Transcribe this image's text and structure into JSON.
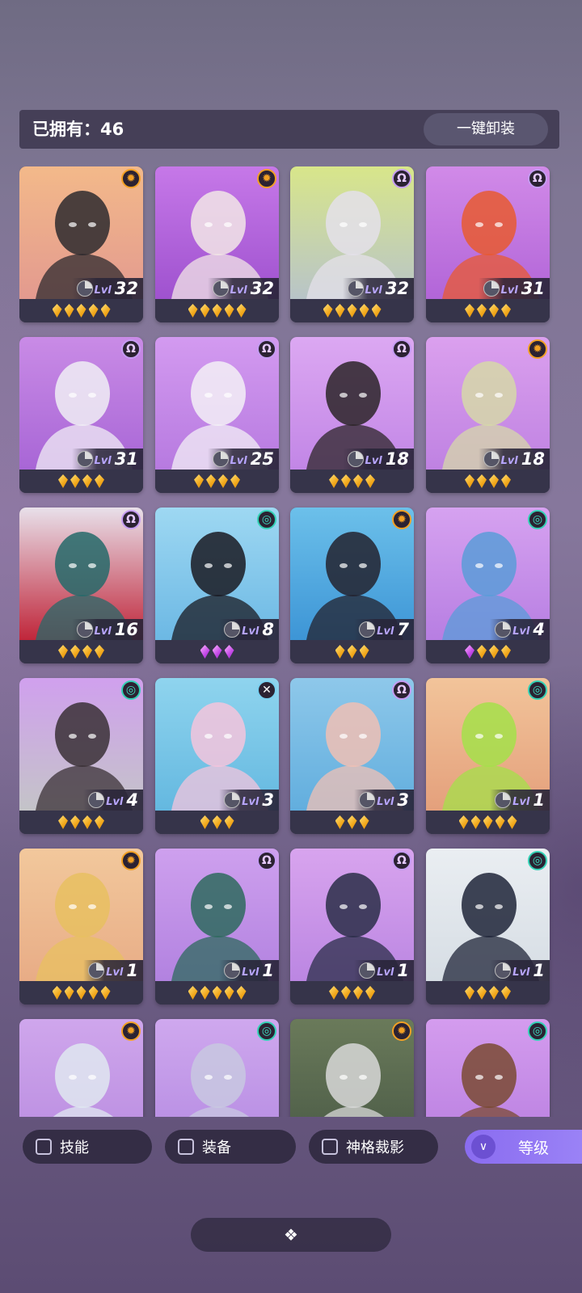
{
  "header": {
    "owned_label": "已拥有：46",
    "unequip_all": "一键卸装"
  },
  "cards": [
    {
      "level": "32",
      "lvl_label": "Lvl",
      "stars": 5,
      "gem": "gold",
      "faction_icon": "sun-icon",
      "bg": [
        "#f3b98a",
        "#e39a8f"
      ],
      "tone": "#2d2a2e"
    },
    {
      "level": "32",
      "lvl_label": "Lvl",
      "stars": 5,
      "gem": "gold",
      "faction_icon": "sun-icon",
      "bg": [
        "#c678e8",
        "#9f52cf"
      ],
      "tone": "#f2e6e6"
    },
    {
      "level": "32",
      "lvl_label": "Lvl",
      "stars": 5,
      "gem": "gold",
      "faction_icon": "omega-icon",
      "bg": [
        "#d8e68a",
        "#b8c4c8"
      ],
      "tone": "#e4e0ea"
    },
    {
      "level": "31",
      "lvl_label": "Lvl",
      "stars": 4,
      "gem": "gold",
      "faction_icon": "omega-icon",
      "bg": [
        "#d18ae8",
        "#b265d8"
      ],
      "tone": "#e85a30"
    },
    {
      "level": "31",
      "lvl_label": "Lvl",
      "stars": 4,
      "gem": "gold",
      "faction_icon": "omega-icon",
      "bg": [
        "#c98be6",
        "#a866d6"
      ],
      "tone": "#f0eef4"
    },
    {
      "level": "25",
      "lvl_label": "Lvl",
      "stars": 4,
      "gem": "gold",
      "faction_icon": "omega-icon",
      "bg": [
        "#d39af0",
        "#b77ae0"
      ],
      "tone": "#f3f0f6"
    },
    {
      "level": "18",
      "lvl_label": "Lvl",
      "stars": 4,
      "gem": "gold",
      "faction_icon": "omega-icon",
      "bg": [
        "#dca8f2",
        "#c286e6"
      ],
      "tone": "#2c2528"
    },
    {
      "level": "18",
      "lvl_label": "Lvl",
      "stars": 4,
      "gem": "gold",
      "faction_icon": "sun-icon",
      "bg": [
        "#dba0ee",
        "#bf82e2"
      ],
      "tone": "#d6d8a8"
    },
    {
      "level": "16",
      "lvl_label": "Lvl",
      "stars": 4,
      "gem": "gold",
      "faction_icon": "omega-icon",
      "bg": [
        "#e8e0ea",
        "#c0263a"
      ],
      "tone": "#256a6a"
    },
    {
      "level": "8",
      "lvl_label": "Lvl",
      "stars": 3,
      "gem": "purple",
      "faction_icon": "spiral-icon",
      "bg": [
        "#9ed8f2",
        "#6cb8e4"
      ],
      "tone": "#1a1a22"
    },
    {
      "level": "7",
      "lvl_label": "Lvl",
      "stars": 3,
      "gem": "gold",
      "faction_icon": "sun-icon",
      "bg": [
        "#6cc0ea",
        "#3d95d6"
      ],
      "tone": "#23222e"
    },
    {
      "level": "4",
      "lvl_label": "Lvl",
      "stars": 4,
      "gem": "mixed",
      "faction_icon": "spiral-icon",
      "bg": [
        "#d6a2f0",
        "#b77ee2"
      ],
      "tone": "#5a9cd8"
    },
    {
      "level": "4",
      "lvl_label": "Lvl",
      "stars": 4,
      "gem": "gold",
      "faction_icon": "spiral-icon",
      "bg": [
        "#d0a0ee",
        "#c4c4c8"
      ],
      "tone": "#3a3036"
    },
    {
      "level": "3",
      "lvl_label": "Lvl",
      "stars": 3,
      "gem": "gold",
      "faction_icon": "cross-icon",
      "bg": [
        "#8fd4ee",
        "#64b8e0"
      ],
      "tone": "#f4c4dc"
    },
    {
      "level": "3",
      "lvl_label": "Lvl",
      "stars": 3,
      "gem": "gold",
      "faction_icon": "omega-icon",
      "bg": [
        "#8ec8ea",
        "#62aede"
      ],
      "tone": "#f0c0b4"
    },
    {
      "level": "1",
      "lvl_label": "Lvl",
      "stars": 5,
      "gem": "gold",
      "faction_icon": "spiral-icon",
      "bg": [
        "#f2c49a",
        "#e4a07c"
      ],
      "tone": "#a4e04a"
    },
    {
      "level": "1",
      "lvl_label": "Lvl",
      "stars": 5,
      "gem": "gold",
      "faction_icon": "sun-icon",
      "bg": [
        "#f2c89c",
        "#e8ac86"
      ],
      "tone": "#e8c060"
    },
    {
      "level": "1",
      "lvl_label": "Lvl",
      "stars": 5,
      "gem": "gold",
      "faction_icon": "omega-icon",
      "bg": [
        "#cea0ee",
        "#b282e0"
      ],
      "tone": "#2e6a5e"
    },
    {
      "level": "1",
      "lvl_label": "Lvl",
      "stars": 4,
      "gem": "gold",
      "faction_icon": "omega-icon",
      "bg": [
        "#d8a4ee",
        "#bb86e2"
      ],
      "tone": "#2a2e48"
    },
    {
      "level": "1",
      "lvl_label": "Lvl",
      "stars": 4,
      "gem": "gold",
      "faction_icon": "spiral-icon",
      "bg": [
        "#eaeef2",
        "#d6dde4"
      ],
      "tone": "#1f2438"
    },
    {
      "level": "",
      "lvl_label": "",
      "stars": 0,
      "gem": "gold",
      "faction_icon": "sun-icon",
      "bg": [
        "#cfa6ec",
        "#b98ce0"
      ],
      "tone": "#dfe8f0"
    },
    {
      "level": "",
      "lvl_label": "",
      "stars": 0,
      "gem": "gold",
      "faction_icon": "spiral-icon",
      "bg": [
        "#cfa8ee",
        "#b48ae2"
      ],
      "tone": "#c8c8e0"
    },
    {
      "level": "",
      "lvl_label": "",
      "stars": 0,
      "gem": "gold",
      "faction_icon": "sun-icon",
      "bg": [
        "#6a7a5a",
        "#4a5a46"
      ],
      "tone": "#d8d8d8"
    },
    {
      "level": "",
      "lvl_label": "",
      "stars": 0,
      "gem": "gold",
      "faction_icon": "spiral-icon",
      "bg": [
        "#d49cee",
        "#b87ee0"
      ],
      "tone": "#7a4a32"
    }
  ],
  "filters": [
    {
      "label": "技能",
      "checked": false
    },
    {
      "label": "装备",
      "checked": false
    },
    {
      "label": "神格裁影",
      "checked": false
    }
  ],
  "sort": {
    "label": "等级",
    "icon": "double-chevron-down-icon"
  },
  "menu_handle": {
    "icon": "diamonds-icon"
  }
}
